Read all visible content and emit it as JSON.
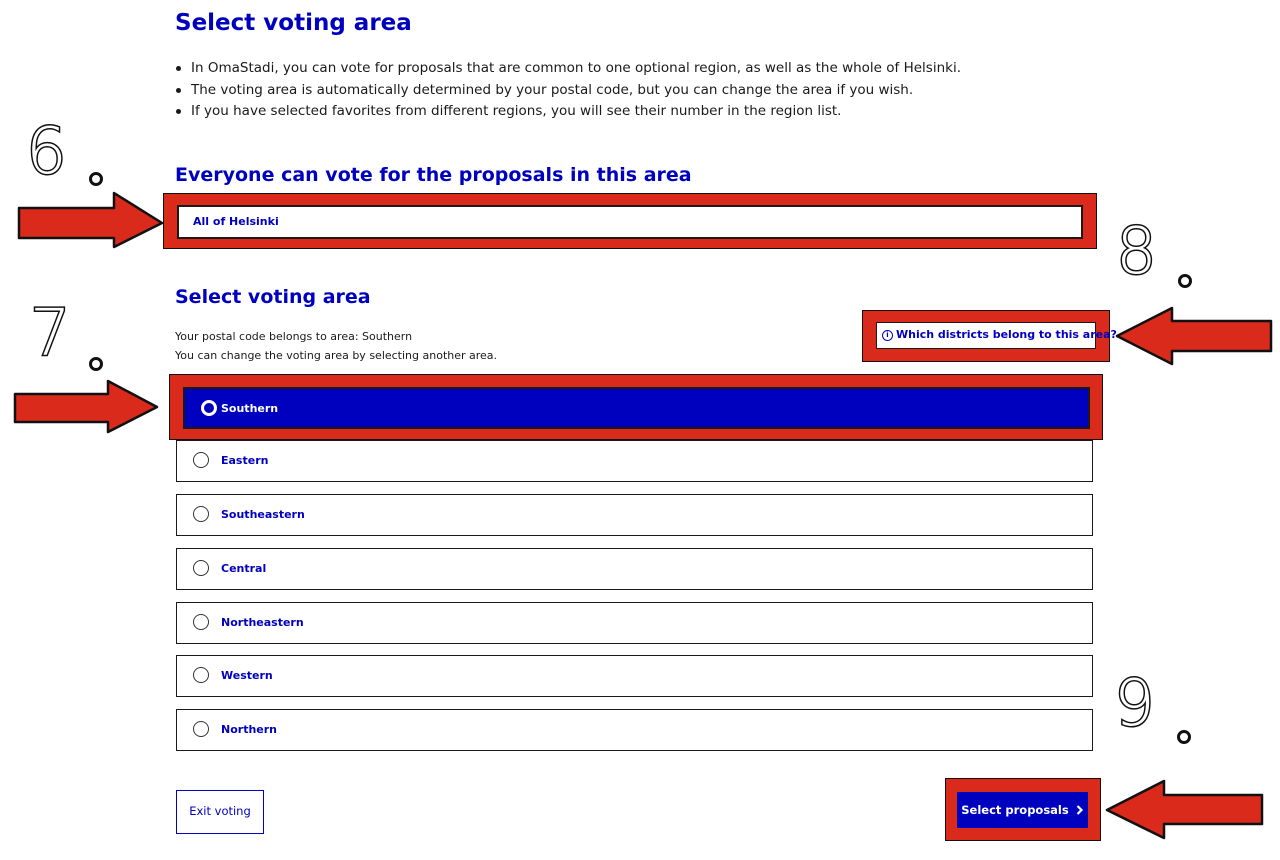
{
  "page": {
    "title": "Select voting area",
    "bullets": [
      "In OmaStadi, you can vote for proposals that are common to one optional region, as well as the whole of Helsinki.",
      "The voting area is automatically determined by your postal code, but you can change the area if you wish.",
      "If you have selected favorites from different regions, you will see their number in the region list."
    ]
  },
  "everyone_section": {
    "heading": "Everyone can vote for the proposals in this area",
    "area": "All of Helsinki"
  },
  "select_section": {
    "heading": "Select voting area",
    "postal_line": "Your postal code belongs to area: Southern",
    "change_line": "You can change the voting area by selecting another area.",
    "info_link": "Which districts belong to this area?",
    "options": [
      {
        "label": "Southern",
        "selected": true
      },
      {
        "label": "Eastern",
        "selected": false
      },
      {
        "label": "Southeastern",
        "selected": false
      },
      {
        "label": "Central",
        "selected": false
      },
      {
        "label": "Northeastern",
        "selected": false
      },
      {
        "label": "Western",
        "selected": false
      },
      {
        "label": "Northern",
        "selected": false
      }
    ]
  },
  "footer": {
    "exit_label": "Exit voting",
    "next_label": "Select proposals",
    "next_icon": "chevron-right-icon"
  },
  "annotations": {
    "steps": [
      "6",
      "7",
      "8",
      "9"
    ],
    "highlight_color": "#da2a1c"
  },
  "colors": {
    "brand": "#0000bf",
    "highlight": "#da2a1c"
  }
}
